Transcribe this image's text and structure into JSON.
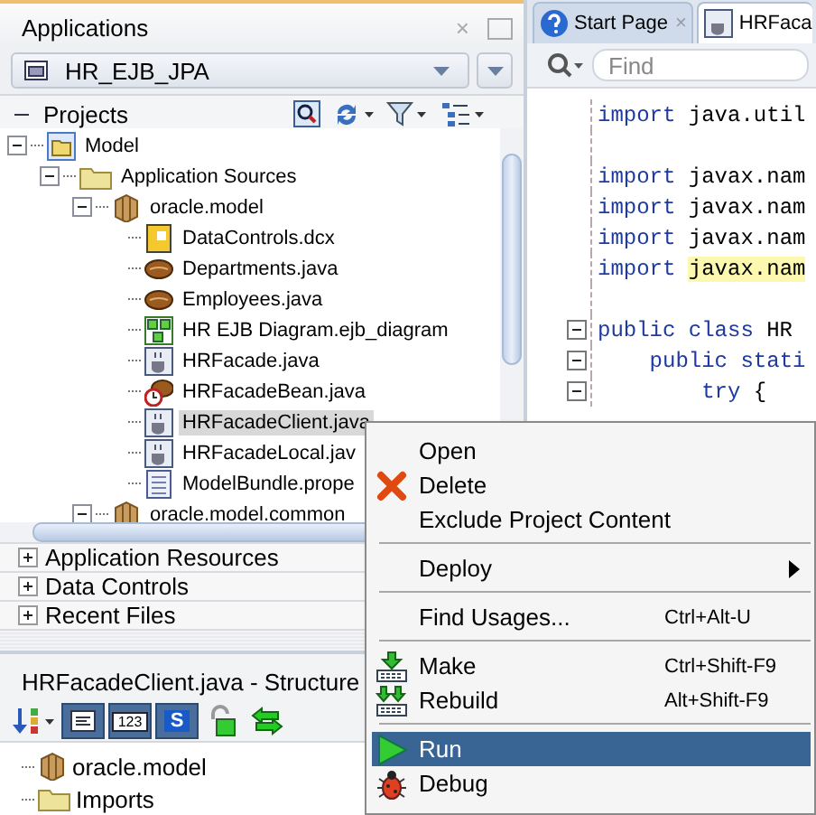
{
  "applications": {
    "title": "Applications",
    "close": "×",
    "app_selector": "HR_EJB_JPA",
    "projects_label": "Projects",
    "tree": [
      {
        "label": "Model",
        "kind": "project",
        "expanded": true,
        "selected": false,
        "children": [
          {
            "label": "Application Sources",
            "kind": "folder",
            "expanded": true,
            "selected": false,
            "children": [
              {
                "label": "oracle.model",
                "kind": "package",
                "expanded": true,
                "selected": false,
                "children": [
                  {
                    "label": "DataControls.dcx",
                    "kind": "dcx",
                    "selected": false
                  },
                  {
                    "label": "Departments.java",
                    "kind": "bean",
                    "selected": false
                  },
                  {
                    "label": "Employees.java",
                    "kind": "bean",
                    "selected": false
                  },
                  {
                    "label": "HR EJB Diagram.ejb_diagram",
                    "kind": "diagram",
                    "selected": false
                  },
                  {
                    "label": "HRFacade.java",
                    "kind": "interface",
                    "selected": false
                  },
                  {
                    "label": "HRFacadeBean.java",
                    "kind": "session-bean",
                    "selected": false
                  },
                  {
                    "label": "HRFacadeClient.java",
                    "kind": "interface",
                    "selected": true
                  },
                  {
                    "label": "HRFacadeLocal.jav",
                    "kind": "interface",
                    "selected": false
                  },
                  {
                    "label": "ModelBundle.prope",
                    "kind": "properties",
                    "selected": false
                  }
                ]
              },
              {
                "label": "oracle.model.common",
                "kind": "package",
                "expanded": true,
                "selected": false
              }
            ]
          }
        ]
      }
    ],
    "accordions": [
      {
        "label": "Application Resources",
        "expanded": false
      },
      {
        "label": "Data Controls",
        "expanded": false
      },
      {
        "label": "Recent Files",
        "expanded": false
      }
    ]
  },
  "structure": {
    "title": "HRFacadeClient.java - Structure",
    "toolbar": [
      {
        "kind": "sort"
      },
      {
        "kind": "list"
      },
      {
        "kind": "text",
        "label": "123"
      },
      {
        "kind": "text-blue",
        "label": "S"
      },
      {
        "kind": "lock"
      },
      {
        "kind": "sync"
      }
    ],
    "tree": [
      {
        "label": "oracle.model",
        "kind": "package"
      },
      {
        "label": "Imports",
        "kind": "folder"
      }
    ]
  },
  "editor": {
    "tabs": [
      {
        "label": "Start Page",
        "kind": "help",
        "close": "×",
        "selected": false
      },
      {
        "label": "HRFaca",
        "kind": "interface",
        "selected": true
      }
    ],
    "find": {
      "placeholder": "Find"
    },
    "lines": [
      {
        "kind": "code",
        "keyword": "import",
        "text": "java.util",
        "fold": false,
        "highlight": false
      },
      {
        "kind": "blank"
      },
      {
        "kind": "code",
        "keyword": "import",
        "text": "javax.nam",
        "fold": false,
        "highlight": false
      },
      {
        "kind": "code",
        "keyword": "import",
        "text": "javax.nam",
        "fold": false,
        "highlight": false
      },
      {
        "kind": "code",
        "keyword": "import",
        "text": "javax.nam",
        "fold": false,
        "highlight": false
      },
      {
        "kind": "code",
        "keyword": "import",
        "text": "javax.nam",
        "fold": false,
        "highlight": true
      },
      {
        "kind": "blank"
      },
      {
        "kind": "code",
        "keyword": "public class",
        "text": "HR",
        "fold": true,
        "highlight": false
      },
      {
        "kind": "code",
        "keyword": "    public stati",
        "fold": true
      },
      {
        "kind": "code",
        "keyword": "        try",
        "text": "{",
        "fold": true,
        "highlight": false
      }
    ]
  },
  "context_menu": [
    {
      "kind": "plain",
      "label": "Open",
      "submenu": false,
      "selected": false
    },
    {
      "kind": "delete",
      "label": "Delete",
      "submenu": false,
      "selected": false
    },
    {
      "kind": "plain",
      "label": "Exclude Project Content",
      "submenu": false,
      "selected": false
    },
    {
      "kind": "separator"
    },
    {
      "kind": "plain",
      "label": "Deploy",
      "submenu": true,
      "selected": false
    },
    {
      "kind": "separator"
    },
    {
      "kind": "plain",
      "label": "Find Usages...",
      "shortcut": "Ctrl+Alt-U",
      "submenu": false,
      "selected": false
    },
    {
      "kind": "separator"
    },
    {
      "kind": "make",
      "label": "Make",
      "shortcut": "Ctrl+Shift-F9",
      "submenu": false,
      "selected": false
    },
    {
      "kind": "rebuild",
      "label": "Rebuild",
      "shortcut": "Alt+Shift-F9",
      "submenu": false,
      "selected": false
    },
    {
      "kind": "separator"
    },
    {
      "kind": "run",
      "label": "Run",
      "submenu": false,
      "selected": true
    },
    {
      "kind": "debug",
      "label": "Debug",
      "submenu": false,
      "selected": false
    }
  ]
}
